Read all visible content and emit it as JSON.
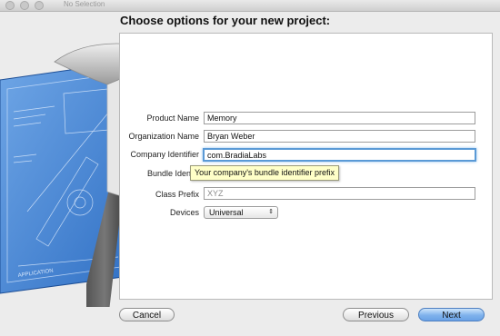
{
  "window": {
    "title": "No Selection"
  },
  "sheet": {
    "heading": "Choose options for your new project:"
  },
  "form": {
    "product_name": {
      "label": "Product Name",
      "value": "Memory"
    },
    "organization_name": {
      "label": "Organization Name",
      "value": "Bryan Weber"
    },
    "company_identifier": {
      "label": "Company Identifier",
      "value": "com.BradiaLabs"
    },
    "bundle_identifier": {
      "label": "Bundle Identifi"
    },
    "class_prefix": {
      "label": "Class Prefix",
      "placeholder": "XYZ"
    },
    "devices": {
      "label": "Devices",
      "value": "Universal",
      "arrows": "⇕"
    }
  },
  "tooltip": {
    "text": "Your company's bundle identifier prefix"
  },
  "buttons": {
    "cancel": "Cancel",
    "previous": "Previous",
    "next": "Next"
  },
  "blueprint": {
    "caption": "APPLICATION"
  },
  "colors": {
    "accent": "#6aa2e6",
    "blueprint": "#3f7fd2",
    "tooltip_bg": "#ffffc8",
    "focus_ring": "#5a9ad6"
  }
}
